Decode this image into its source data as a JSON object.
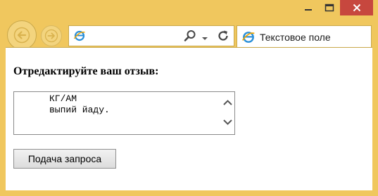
{
  "window": {
    "controls": [
      "minimize",
      "maximize",
      "close"
    ]
  },
  "toolbar": {
    "back_icon": "back-arrow-icon",
    "forward_icon": "forward-arrow-icon",
    "address_value": "",
    "address_icons": [
      "ie-logo-icon",
      "search-icon",
      "chevron-down-icon",
      "refresh-icon"
    ]
  },
  "tab": {
    "title": "Текстовое поле",
    "icon": "ie-logo-icon"
  },
  "page": {
    "heading": "Отредактируйте ваш отзыв:",
    "review_text": "КГ/АМ\nвыпий йаду.",
    "submit_label": "Подача запроса"
  },
  "colors": {
    "frame": "#f0c75e",
    "close_button": "#c7473e",
    "ie_blue": "#2a8fd8"
  }
}
